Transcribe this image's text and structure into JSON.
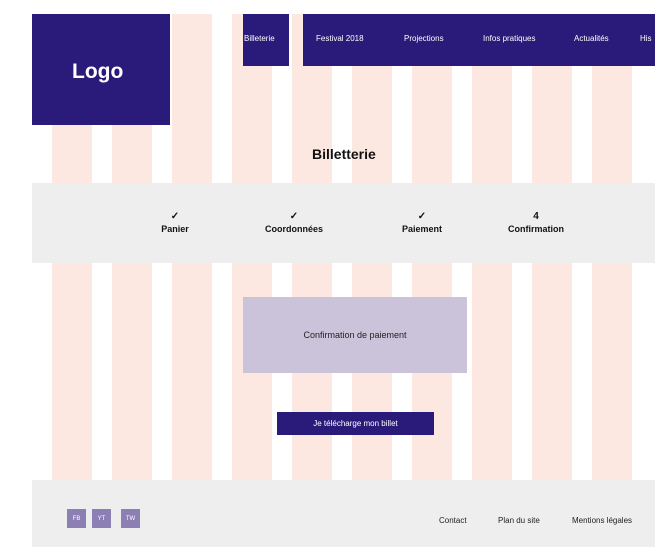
{
  "header": {
    "logo": "Logo",
    "nav": [
      {
        "label": "Billeterie"
      },
      {
        "label": "Festival 2018"
      },
      {
        "label": "Projections"
      },
      {
        "label": "Infos pratiques"
      },
      {
        "label": "Actualités"
      },
      {
        "label": "His"
      }
    ]
  },
  "main": {
    "title": "Billetterie",
    "steps": [
      {
        "mark": "✓",
        "label": "Panier"
      },
      {
        "mark": "✓",
        "label": "Coordonnées"
      },
      {
        "mark": "✓",
        "label": "Paiement"
      },
      {
        "mark": "4",
        "label": "Confirmation"
      }
    ],
    "confirmation_message": "Confirmation de paiement",
    "download_button": "Je télécharge mon billet"
  },
  "footer": {
    "social": [
      "FB",
      "YT",
      "TW"
    ],
    "links": [
      "Contact",
      "Plan du site",
      "Mentions légales"
    ]
  },
  "colors": {
    "primary": "#2a1a7a",
    "grid_overlay": "#fde7e1",
    "band": "#eeeeee",
    "card": "#cbc3d9",
    "social": "#8b7fb3"
  }
}
